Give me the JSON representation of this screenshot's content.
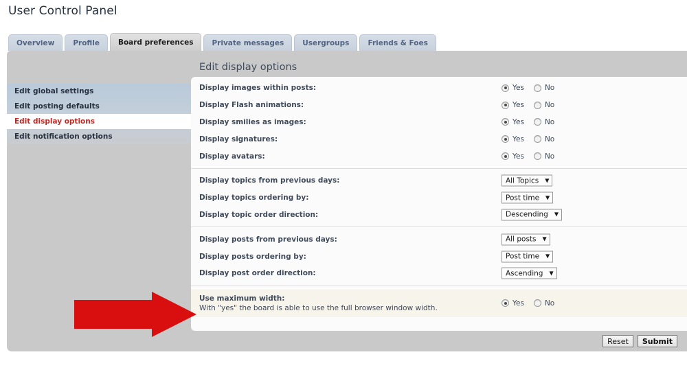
{
  "page": {
    "title": "User Control Panel"
  },
  "tabs": [
    {
      "label": "Overview",
      "active": false
    },
    {
      "label": "Profile",
      "active": false
    },
    {
      "label": "Board preferences",
      "active": true
    },
    {
      "label": "Private messages",
      "active": false
    },
    {
      "label": "Usergroups",
      "active": false
    },
    {
      "label": "Friends & Foes",
      "active": false
    }
  ],
  "sidebar": {
    "items": [
      {
        "label": "Edit global settings",
        "active": false
      },
      {
        "label": "Edit posting defaults",
        "active": false
      },
      {
        "label": "Edit display options",
        "active": true
      },
      {
        "label": "Edit notification options",
        "active": false
      }
    ]
  },
  "content": {
    "header": "Edit display options",
    "radio_yes_label": "Yes",
    "radio_no_label": "No",
    "group_display": [
      {
        "label": "Display images within posts:",
        "value": "Yes"
      },
      {
        "label": "Display Flash animations:",
        "value": "Yes"
      },
      {
        "label": "Display smilies as images:",
        "value": "Yes"
      },
      {
        "label": "Display signatures:",
        "value": "Yes"
      },
      {
        "label": "Display avatars:",
        "value": "Yes"
      }
    ],
    "group_topics": [
      {
        "label": "Display topics from previous days:",
        "value": "All Topics"
      },
      {
        "label": "Display topics ordering by:",
        "value": "Post time"
      },
      {
        "label": "Display topic order direction:",
        "value": "Descending"
      }
    ],
    "group_posts": [
      {
        "label": "Display posts from previous days:",
        "value": "All posts"
      },
      {
        "label": "Display posts ordering by:",
        "value": "Post time"
      },
      {
        "label": "Display post order direction:",
        "value": "Ascending"
      }
    ],
    "max_width": {
      "label": "Use maximum width:",
      "description": "With \"yes\" the board is able to use the full browser window width.",
      "value": "Yes"
    }
  },
  "buttons": {
    "reset": "Reset",
    "submit": "Submit"
  },
  "annotation": {
    "arrow_color": "#d90f0f",
    "arrow_direction": "right"
  },
  "colors": {
    "panel_bg": "#c9c9c9",
    "content_bg": "#fbfbfb",
    "tab_bg": "#cdd6e0",
    "tab_active_bg": "#d1d1d1",
    "sidebar_top": "#b9cada",
    "sidebar_bottom": "#c9cccf",
    "active_nav_text": "#bc2a24",
    "label_text": "#3f4a5a",
    "highlight_row_bg": "#f7f4ec"
  }
}
